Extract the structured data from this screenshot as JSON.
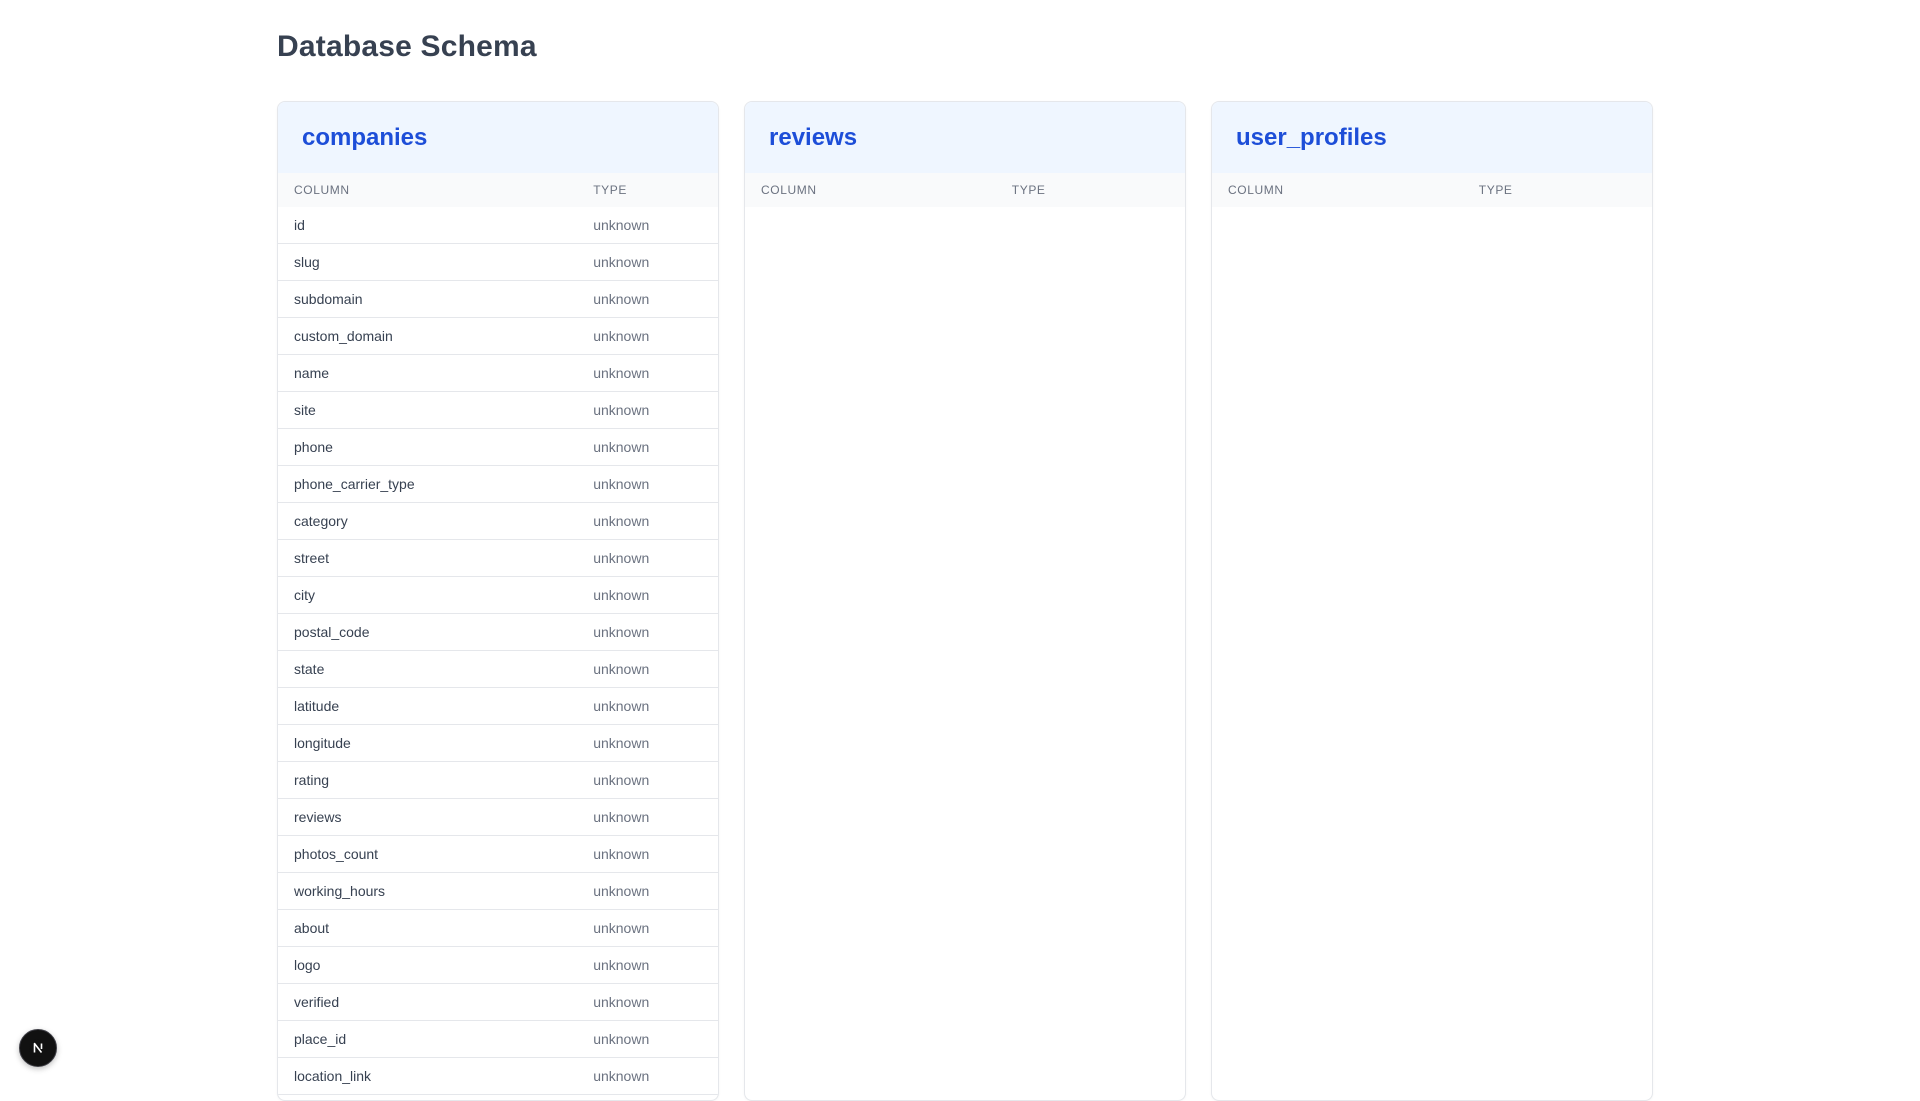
{
  "page": {
    "title": "Database Schema"
  },
  "tables": [
    {
      "name": "companies",
      "headers": {
        "column": "COLUMN",
        "type": "TYPE"
      },
      "rows": [
        {
          "column": "id",
          "type": "unknown"
        },
        {
          "column": "slug",
          "type": "unknown"
        },
        {
          "column": "subdomain",
          "type": "unknown"
        },
        {
          "column": "custom_domain",
          "type": "unknown"
        },
        {
          "column": "name",
          "type": "unknown"
        },
        {
          "column": "site",
          "type": "unknown"
        },
        {
          "column": "phone",
          "type": "unknown"
        },
        {
          "column": "phone_carrier_type",
          "type": "unknown"
        },
        {
          "column": "category",
          "type": "unknown"
        },
        {
          "column": "street",
          "type": "unknown"
        },
        {
          "column": "city",
          "type": "unknown"
        },
        {
          "column": "postal_code",
          "type": "unknown"
        },
        {
          "column": "state",
          "type": "unknown"
        },
        {
          "column": "latitude",
          "type": "unknown"
        },
        {
          "column": "longitude",
          "type": "unknown"
        },
        {
          "column": "rating",
          "type": "unknown"
        },
        {
          "column": "reviews",
          "type": "unknown"
        },
        {
          "column": "photos_count",
          "type": "unknown"
        },
        {
          "column": "working_hours",
          "type": "unknown"
        },
        {
          "column": "about",
          "type": "unknown"
        },
        {
          "column": "logo",
          "type": "unknown"
        },
        {
          "column": "verified",
          "type": "unknown"
        },
        {
          "column": "place_id",
          "type": "unknown"
        },
        {
          "column": "location_link",
          "type": "unknown"
        }
      ]
    },
    {
      "name": "reviews",
      "headers": {
        "column": "COLUMN",
        "type": "TYPE"
      },
      "rows": []
    },
    {
      "name": "user_profiles",
      "headers": {
        "column": "COLUMN",
        "type": "TYPE"
      },
      "rows": []
    }
  ],
  "dev_indicator": {
    "icon": "nextjs-logo-icon",
    "label": "N"
  },
  "colors": {
    "accent": "#1d4ed8",
    "header_bg": "#eff6ff",
    "border": "#e5e7eb",
    "muted_text": "#6b7280"
  }
}
